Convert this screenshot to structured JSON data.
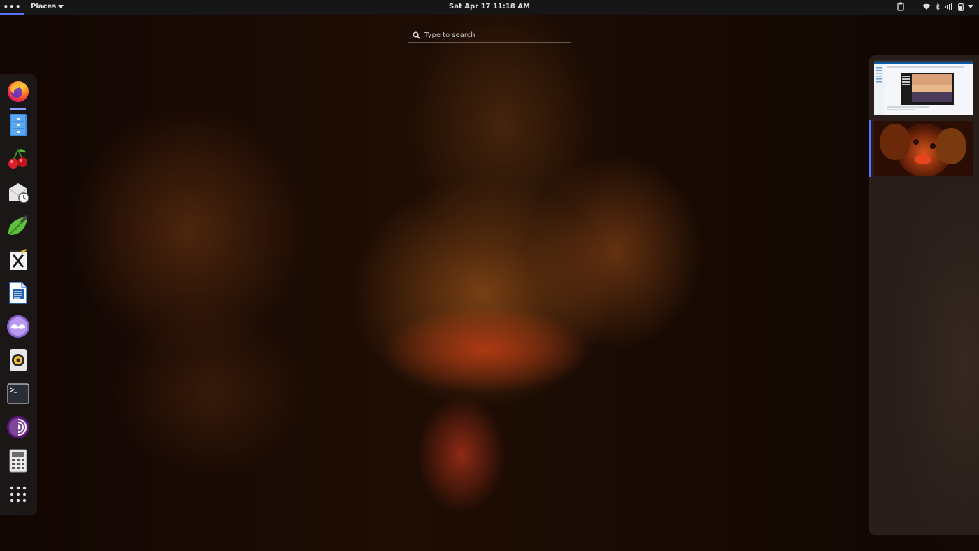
{
  "topbar": {
    "activities_label": "•••",
    "places_label": "Places",
    "clock": "Sat Apr 17  11:18 AM"
  },
  "tray_icons": [
    "clipboard-icon",
    "wifi-icon",
    "bluetooth-icon",
    "volume-icon",
    "battery-icon",
    "system-menu-caret-icon"
  ],
  "search": {
    "placeholder": "Type to search"
  },
  "dock": {
    "apps": [
      {
        "name": "firefox",
        "icon": "firefox-icon",
        "running": true
      },
      {
        "name": "files",
        "icon": "files-icon",
        "running": false
      },
      {
        "name": "cherrytree",
        "icon": "cherry-icon",
        "running": false
      },
      {
        "name": "mail-scheduler",
        "icon": "mail-clock-icon",
        "running": false
      },
      {
        "name": "text-editor",
        "icon": "leaf-pen-icon",
        "running": false
      },
      {
        "name": "xournal",
        "icon": "notepad-x-icon",
        "running": false
      },
      {
        "name": "libreoffice-writer",
        "icon": "writer-icon",
        "running": false
      },
      {
        "name": "tor-mustache",
        "icon": "mustache-icon",
        "running": false
      },
      {
        "name": "rhythmbox",
        "icon": "speaker-icon",
        "running": false
      },
      {
        "name": "terminal",
        "icon": "terminal-icon",
        "running": false
      },
      {
        "name": "tor-browser",
        "icon": "tor-icon",
        "running": false
      },
      {
        "name": "calculator",
        "icon": "calculator-icon",
        "running": false
      },
      {
        "name": "show-applications",
        "icon": "app-grid-icon",
        "running": false
      }
    ]
  },
  "workspaces": [
    {
      "name": "workspace-1",
      "active": false
    },
    {
      "name": "workspace-2",
      "active": true
    }
  ],
  "colors": {
    "accent": "#5a72ff",
    "topbar": "#161616"
  }
}
